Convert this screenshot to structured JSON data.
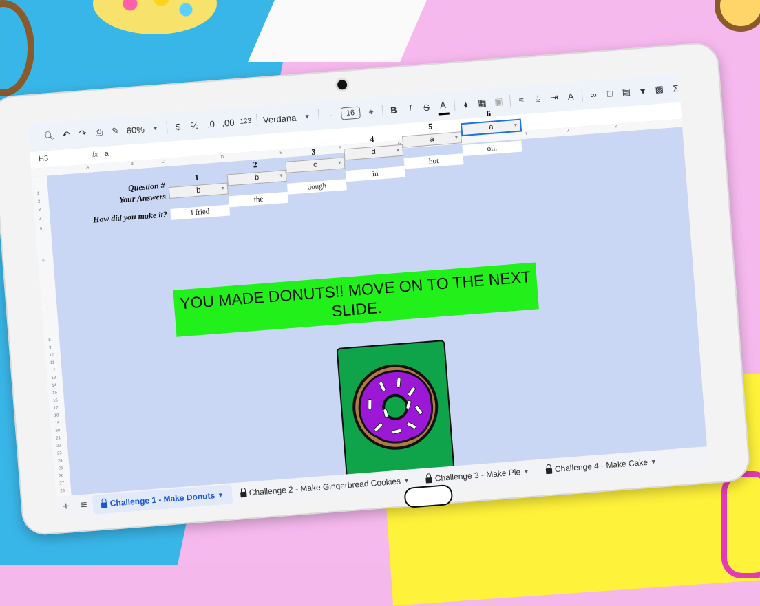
{
  "toolbar": {
    "zoom": "60%",
    "currency": "$",
    "percent": "%",
    "dec_decrease": ".0",
    "dec_increase": ".00",
    "number_format": "123",
    "font": "Verdana",
    "font_size": "16",
    "bold": "B",
    "italic": "I",
    "text_color": "A"
  },
  "formula_bar": {
    "cell_ref": "H3",
    "fx": "fx",
    "value": "a"
  },
  "columns": [
    "A",
    "B",
    "C",
    "D",
    "E",
    "F",
    "G",
    "H",
    "I",
    "J",
    "K"
  ],
  "rows": [
    "1",
    "2",
    "3",
    "4",
    "5",
    "6",
    "7",
    "8",
    "9",
    "10",
    "11",
    "12",
    "13",
    "14",
    "15",
    "16",
    "17",
    "18",
    "19",
    "20",
    "21",
    "22",
    "23",
    "24",
    "25",
    "26",
    "27",
    "28"
  ],
  "sheet": {
    "question_label": "Question #",
    "answers_label": "Your Answers",
    "how_label": "How did you make it?",
    "questions": [
      "1",
      "2",
      "3",
      "4",
      "5",
      "6"
    ],
    "answers": [
      "b",
      "b",
      "c",
      "d",
      "a",
      "a"
    ],
    "sentence": [
      "I fried",
      "the",
      "dough",
      "in",
      "hot",
      "oil."
    ],
    "banner": "YOU MADE DONUTS!! MOVE ON TO THE NEXT SLIDE."
  },
  "tabs": [
    {
      "label": "Challenge 1 - Make Donuts",
      "active": true
    },
    {
      "label": "Challenge 2 - Make Gingerbread Cookies",
      "active": false
    },
    {
      "label": "Challenge 3 - Make Pie",
      "active": false
    },
    {
      "label": "Challenge 4 - Make Cake",
      "active": false
    }
  ],
  "colors": {
    "sheet_bg": "#c9d7f5",
    "banner_bg": "#22f01a",
    "donut_card": "#0fa34a",
    "icing": "#9b19d6",
    "dough": "#b07a45",
    "active_tab": "#1a56d6"
  }
}
